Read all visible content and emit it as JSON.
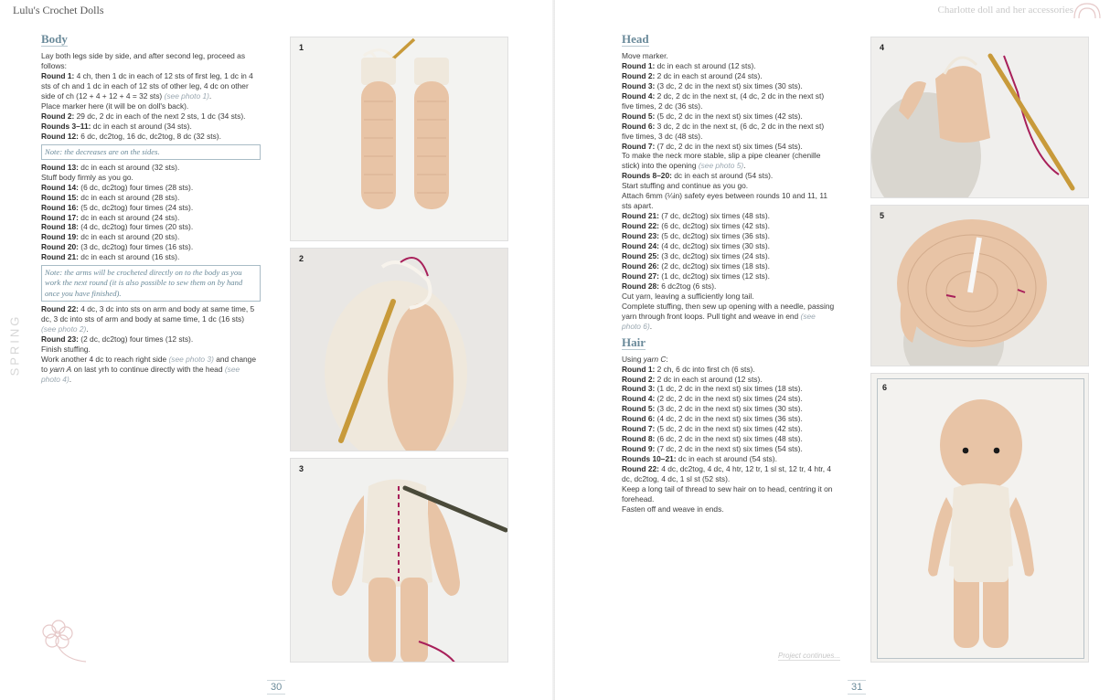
{
  "header": {
    "book_title": "Lulu's Crochet Dolls",
    "chapter_title": "Charlotte doll and her accessories"
  },
  "side_tab": "SPRING",
  "left_page": {
    "page_number": "30",
    "body": {
      "title": "Body",
      "intro": "Lay both legs side by side, and after second leg, proceed as follows:",
      "r1_label": "Round 1:",
      "r1_text": "4 ch, then 1 dc in each of 12 sts of first leg, 1 dc in 4 sts of ch and 1 dc in each of 12 sts of other leg, 4 dc on other side of ch (12 + 4 + 12 + 4 = 32 sts)",
      "r1_ref": "(see photo 1)",
      "marker_text": "Place marker here (it will be on doll's back).",
      "r2_label": "Round 2:",
      "r2_text": "29 dc, 2 dc in each of the next 2 sts, 1 dc (34 sts).",
      "r3_label": "Rounds 3–11:",
      "r3_text": "dc in each st around (34 sts).",
      "r12_label": "Round 12:",
      "r12_text": "6 dc, dc2tog, 16 dc, dc2tog, 8 dc (32 sts).",
      "note1": "Note: the decreases are on the sides.",
      "r13_label": "Round 13:",
      "r13_text": "dc in each st around (32 sts).",
      "stuff_text": "Stuff body firmly as you go.",
      "r14_label": "Round 14:",
      "r14_text": "(6 dc, dc2tog) four times (28 sts).",
      "r15_label": "Round 15:",
      "r15_text": "dc in each st around (28 sts).",
      "r16_label": "Round 16:",
      "r16_text": "(5 dc, dc2tog) four times (24 sts).",
      "r17_label": "Round 17:",
      "r17_text": "dc in each st around (24 sts).",
      "r18_label": "Round 18:",
      "r18_text": "(4 dc, dc2tog) four times (20 sts).",
      "r19_label": "Round 19:",
      "r19_text": "dc in each st around (20 sts).",
      "r20_label": "Round 20:",
      "r20_text": "(3 dc, dc2tog) four times (16 sts).",
      "r21_label": "Round 21:",
      "r21_text": "dc in each st around (16 sts).",
      "note2": "Note: the arms will be crocheted directly on to the body as you work the next round (it is also possible to sew them on by hand once you have finished).",
      "r22_label": "Round 22:",
      "r22_text": "4 dc, 3 dc into sts on arm and body at same time, 5 dc, 3 dc into sts of arm and body at same time, 1 dc (16 sts)",
      "r22_ref": "(see photo 2)",
      "r23_label": "Round 23:",
      "r23_text": "(2 dc, dc2tog) four times (12 sts).",
      "finish_text": "Finish stuffing.",
      "work_text_a": "Work another 4 dc to reach right side",
      "work_ref": "(see photo 3)",
      "work_text_b": "and change to",
      "work_yarn": "yarn A",
      "work_text_c": "on last yrh to continue directly with the head",
      "work_ref2": "(see photo 4)"
    },
    "photos": [
      "1",
      "2",
      "3"
    ]
  },
  "right_page": {
    "page_number": "31",
    "continues": "Project continues...",
    "head": {
      "title": "Head",
      "move_marker": "Move marker.",
      "rounds_a": [
        {
          "label": "Round 1:",
          "text": "dc in each st around (12 sts)."
        },
        {
          "label": "Round 2:",
          "text": "2 dc in each st around (24 sts)."
        },
        {
          "label": "Round 3:",
          "text": "(3 dc, 2 dc in the next st) six times (30 sts)."
        },
        {
          "label": "Round 4:",
          "text": "2 dc, 2 dc in the next st, (4 dc, 2 dc in the next st) five times, 2 dc (36 sts)."
        },
        {
          "label": "Round 5:",
          "text": "(5 dc, 2 dc in the next st) six times (42 sts)."
        },
        {
          "label": "Round 6:",
          "text": "3 dc, 2 dc in the next st, (6 dc, 2 dc in the next st) five times, 3 dc (48 sts)."
        },
        {
          "label": "Round 7:",
          "text": "(7 dc, 2 dc in the next st) six times (54 sts)."
        }
      ],
      "neck_text": "To make the neck more stable, slip a pipe cleaner (chenille stick) into the opening",
      "neck_ref": "(see photo 5)",
      "r8_label": "Rounds 8–20:",
      "r8_text": "dc in each st around (54 sts).",
      "start_stuffing": "Start stuffing and continue as you go.",
      "eyes_text": "Attach 6mm (¼in) safety eyes between rounds 10 and 11, 11 sts apart.",
      "rounds_b": [
        {
          "label": "Round 21:",
          "text": "(7 dc, dc2tog) six times (48 sts)."
        },
        {
          "label": "Round 22:",
          "text": "(6 dc, dc2tog) six times (42 sts)."
        },
        {
          "label": "Round 23:",
          "text": "(5 dc, dc2tog) six times (36 sts)."
        },
        {
          "label": "Round 24:",
          "text": "(4 dc, dc2tog) six times (30 sts)."
        },
        {
          "label": "Round 25:",
          "text": "(3 dc, dc2tog) six times (24 sts)."
        },
        {
          "label": "Round 26:",
          "text": "(2 dc, dc2tog) six times (18 sts)."
        },
        {
          "label": "Round 27:",
          "text": "(1 dc, dc2tog) six times (12 sts)."
        },
        {
          "label": "Round 28:",
          "text": "6 dc2tog (6 sts)."
        }
      ],
      "cut_text": "Cut yarn, leaving a sufficiently long tail.",
      "complete_text": "Complete stuffing, then sew up opening with a needle, passing yarn through front loops. Pull tight and weave in end",
      "complete_ref": "(see photo 6)"
    },
    "hair": {
      "title": "Hair",
      "using": "Using",
      "using_yarn": "yarn C",
      "rounds": [
        {
          "label": "Round 1:",
          "text": "2 ch, 6 dc into first ch (6 sts)."
        },
        {
          "label": "Round 2:",
          "text": "2 dc in each st around (12 sts)."
        },
        {
          "label": "Round 3:",
          "text": "(1 dc, 2 dc in the next st) six times (18 sts)."
        },
        {
          "label": "Round 4:",
          "text": "(2 dc, 2 dc in the next st) six times (24 sts)."
        },
        {
          "label": "Round 5:",
          "text": "(3 dc, 2 dc in the next st) six times (30 sts)."
        },
        {
          "label": "Round 6:",
          "text": "(4 dc, 2 dc in the next st) six times (36 sts)."
        },
        {
          "label": "Round 7:",
          "text": "(5 dc, 2 dc in the next st) six times (42 sts)."
        },
        {
          "label": "Round 8:",
          "text": "(6 dc, 2 dc in the next st) six times (48 sts)."
        },
        {
          "label": "Round 9:",
          "text": "(7 dc, 2 dc in the next st) six times (54 sts)."
        },
        {
          "label": "Rounds 10–21:",
          "text": "dc in each st around (54 sts)."
        },
        {
          "label": "Round 22:",
          "text": "4 dc, dc2tog, 4 dc, 4 htr, 12 tr, 1 sl st, 12 tr, 4 htr, 4 dc, dc2tog, 4 dc, 1 sl st (52 sts)."
        }
      ],
      "tail_text": "Keep a long tail of thread to sew hair on to head, centring it on forehead.",
      "fasten_text": "Fasten off and weave in ends."
    },
    "photos": [
      "4",
      "5",
      "6"
    ]
  },
  "colors": {
    "heading": "#6a8a9a",
    "yarn_beige": "#e8c4a6",
    "yarn_cream": "#efe8dc",
    "yarn_magenta": "#a8205a",
    "hook_gold": "#c89a3a"
  }
}
